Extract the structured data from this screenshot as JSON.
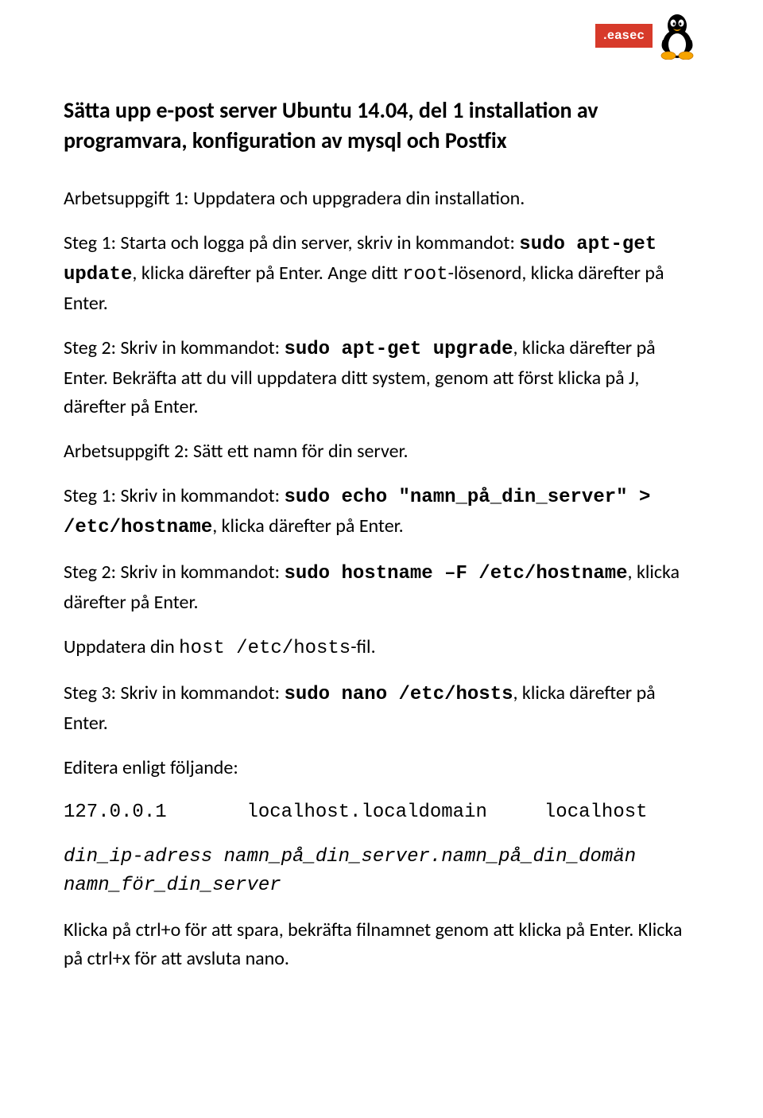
{
  "logo": {
    "badge_text": ".easec"
  },
  "title": "Sätta upp e-post server Ubuntu 14.04, del 1 installation av programvara, konfiguration av mysql och Postfix",
  "p1": "Arbetsuppgift 1: Uppdatera och uppgradera din installation.",
  "p2_a": "Steg 1: Starta och logga på din server, skriv in kommandot: ",
  "p2_cmd": "sudo apt-get update",
  "p2_b": ", klicka därefter på Enter. Ange ditt ",
  "p2_root": "root",
  "p2_c": "-lösenord, klicka därefter på Enter.",
  "p3_a": "Steg 2: Skriv in kommandot: ",
  "p3_cmd": "sudo apt-get upgrade",
  "p3_b": ", klicka därefter på Enter. Bekräfta att du vill uppdatera ditt system, genom att först klicka på J, därefter på Enter.",
  "p4": "Arbetsuppgift 2: Sätt ett namn för din server.",
  "p5_a": "Steg 1: Skriv in kommandot: ",
  "p5_cmd": "sudo echo \"namn_på_din_server\" > /etc/hostname",
  "p5_b": ", klicka därefter på Enter.",
  "p6_a": "Steg 2: Skriv in kommandot: ",
  "p6_cmd": "sudo hostname –F /etc/hostname",
  "p6_b": ", klicka därefter på Enter.",
  "p7_a": "Uppdatera din ",
  "p7_cmd": "host /etc/hosts",
  "p7_b": "-fil.",
  "p8_a": "Steg 3: Skriv in kommandot: ",
  "p8_cmd": "sudo nano /etc/hosts",
  "p8_b": ", klicka därefter på Enter.",
  "p9": "Editera enligt följande:",
  "hosts_line1": "127.0.0.1       localhost.localdomain     localhost",
  "hosts_line2": "din_ip-adress   namn_på_din_server.namn_på_din_domän namn_för_din_server",
  "p10": "Klicka på ctrl+o för att spara, bekräfta filnamnet genom att klicka på Enter. Klicka på ctrl+x för att avsluta nano."
}
